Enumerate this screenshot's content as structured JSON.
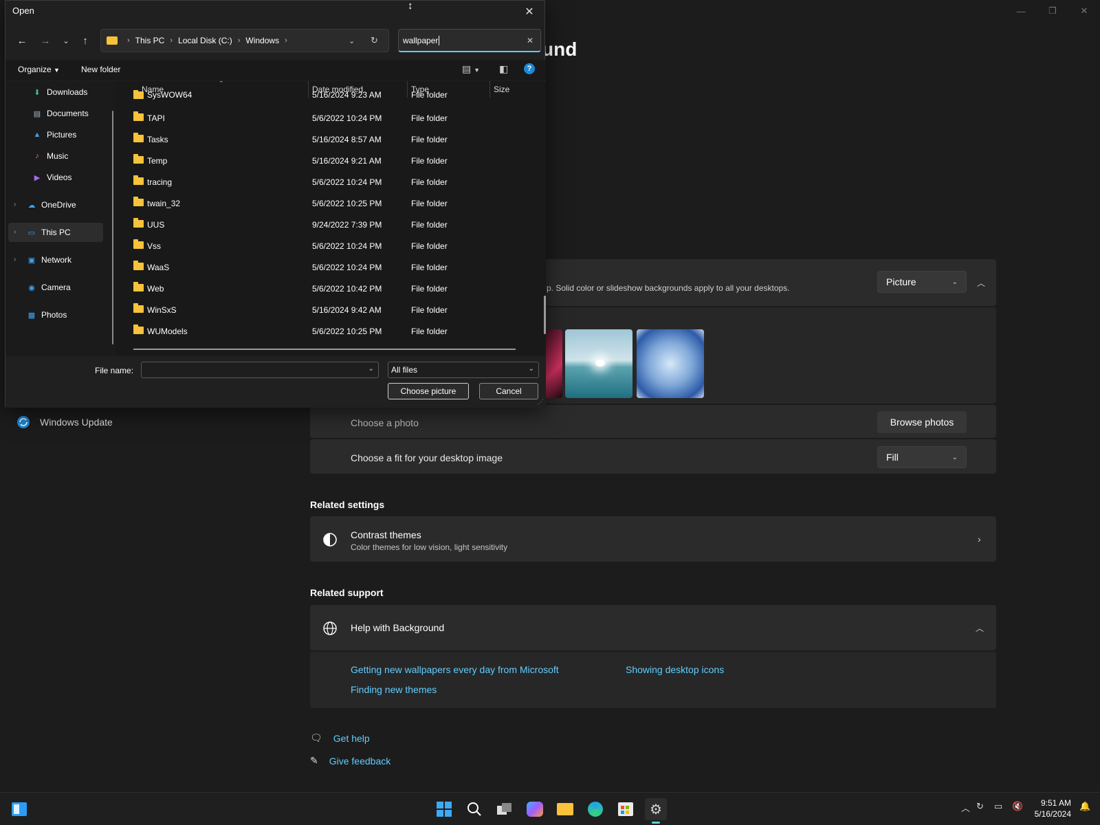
{
  "settings": {
    "title_partial": "und",
    "side_item": "Windows Update",
    "background_desc": "p. Solid color or slideshow backgrounds apply to all your desktops.",
    "background_type": "Picture",
    "choose_photo_label": "Choose a photo",
    "browse_button": "Browse photos",
    "fit_label": "Choose a fit for your desktop image",
    "fit_value": "Fill",
    "related_settings_title": "Related settings",
    "contrast_title": "Contrast themes",
    "contrast_sub": "Color themes for low vision, light sensitivity",
    "related_support_title": "Related support",
    "help_title": "Help with Background",
    "help_links": [
      "Getting new wallpapers every day from Microsoft",
      "Showing desktop icons",
      "Finding new themes"
    ],
    "get_help": "Get help",
    "give_feedback": "Give feedback"
  },
  "dialog": {
    "title": "Open",
    "breadcrumb": [
      "This PC",
      "Local Disk (C:)",
      "Windows"
    ],
    "search_value": "wallpaper",
    "toolbar": {
      "organize": "Organize",
      "new_folder": "New folder"
    },
    "nav": [
      {
        "label": "Downloads",
        "pinned": true
      },
      {
        "label": "Documents",
        "pinned": true
      },
      {
        "label": "Pictures",
        "pinned": true
      },
      {
        "label": "Music"
      },
      {
        "label": "Videos"
      },
      {
        "label": "OneDrive"
      },
      {
        "label": "This PC"
      },
      {
        "label": "Network"
      },
      {
        "label": "Camera"
      },
      {
        "label": "Photos"
      }
    ],
    "columns": [
      "Name",
      "Date modified",
      "Type",
      "Size"
    ],
    "files": [
      {
        "name": "SysWOW64",
        "date": "5/16/2024 9:23 AM",
        "type": "File folder"
      },
      {
        "name": "TAPI",
        "date": "5/6/2022 10:24 PM",
        "type": "File folder"
      },
      {
        "name": "Tasks",
        "date": "5/16/2024 8:57 AM",
        "type": "File folder"
      },
      {
        "name": "Temp",
        "date": "5/16/2024 9:21 AM",
        "type": "File folder"
      },
      {
        "name": "tracing",
        "date": "5/6/2022 10:24 PM",
        "type": "File folder"
      },
      {
        "name": "twain_32",
        "date": "5/6/2022 10:25 PM",
        "type": "File folder"
      },
      {
        "name": "UUS",
        "date": "9/24/2022 7:39 PM",
        "type": "File folder"
      },
      {
        "name": "Vss",
        "date": "5/6/2022 10:24 PM",
        "type": "File folder"
      },
      {
        "name": "WaaS",
        "date": "5/6/2022 10:24 PM",
        "type": "File folder"
      },
      {
        "name": "Web",
        "date": "5/6/2022 10:42 PM",
        "type": "File folder"
      },
      {
        "name": "WinSxS",
        "date": "5/16/2024 9:42 AM",
        "type": "File folder"
      },
      {
        "name": "WUModels",
        "date": "5/6/2022 10:25 PM",
        "type": "File folder"
      }
    ],
    "file_name_label": "File name:",
    "file_name_value": "",
    "file_type": "All files",
    "choose_button": "Choose picture",
    "cancel_button": "Cancel"
  },
  "taskbar": {
    "time": "9:51 AM",
    "date": "5/16/2024"
  },
  "colors": {
    "accent": "#60cdff",
    "folder": "#f8c23a"
  }
}
